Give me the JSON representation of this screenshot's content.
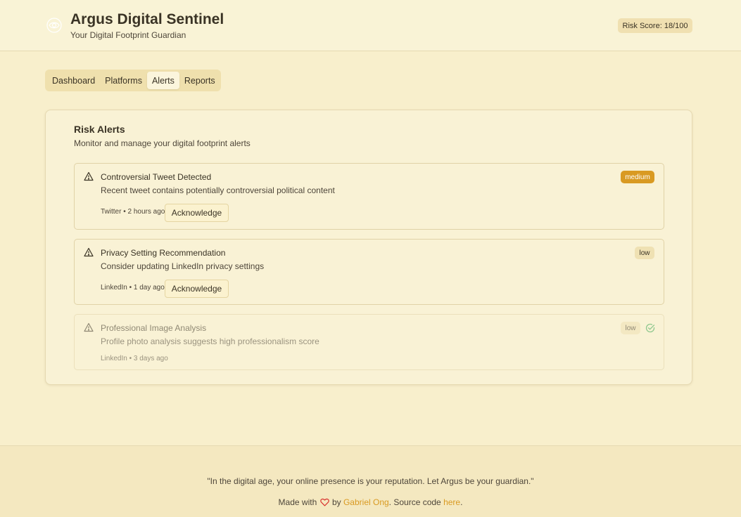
{
  "header": {
    "title": "Argus Digital Sentinel",
    "subtitle": "Your Digital Footprint Guardian",
    "risk_score": "Risk Score: 18/100",
    "logo_icon": "eye-logo-icon"
  },
  "tabs": [
    {
      "label": "Dashboard",
      "active": false
    },
    {
      "label": "Platforms",
      "active": false
    },
    {
      "label": "Alerts",
      "active": true
    },
    {
      "label": "Reports",
      "active": false
    }
  ],
  "alerts_card": {
    "title": "Risk Alerts",
    "subtitle": "Monitor and manage your digital footprint alerts",
    "alerts": [
      {
        "title": "Controversial Tweet Detected",
        "description": "Recent tweet contains potentially controversial political content",
        "meta": "Twitter • 2 hours ago",
        "severity": "medium",
        "action": "Acknowledge",
        "acknowledged": false
      },
      {
        "title": "Privacy Setting Recommendation",
        "description": "Consider updating LinkedIn privacy settings",
        "meta": "LinkedIn • 1 day ago",
        "severity": "low",
        "action": "Acknowledge",
        "acknowledged": false
      },
      {
        "title": "Professional Image Analysis",
        "description": "Profile photo analysis suggests high professionalism score",
        "meta": "LinkedIn • 3 days ago",
        "severity": "low",
        "acknowledged": true
      }
    ]
  },
  "footer": {
    "quote": "\"In the digital age, your online presence is your reputation. Let Argus be your guardian.\"",
    "made_with": "Made with",
    "by": "by",
    "author": "Gabriel Ong",
    "source_text": ". Source code",
    "source_link": "here",
    "period": "."
  },
  "colors": {
    "background": "#f8efcc",
    "accent": "#d99a22",
    "heart": "#d9322e",
    "check": "#3aa655"
  }
}
